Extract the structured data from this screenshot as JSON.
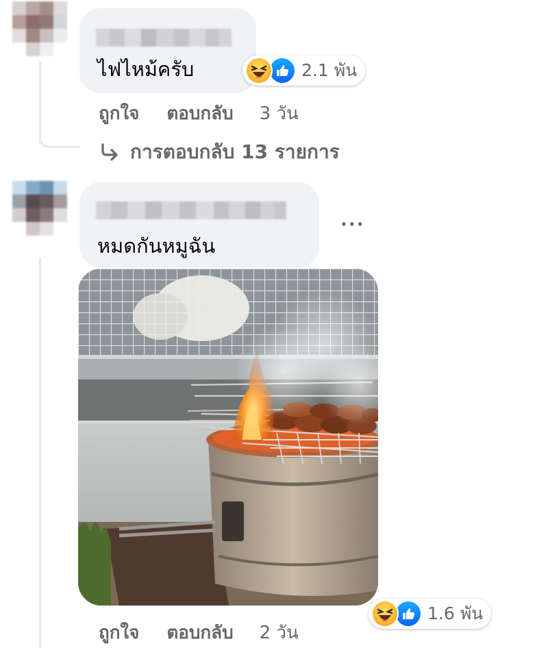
{
  "comments": [
    {
      "text": "ไฟไหม้ครับ",
      "reaction_count": "2.1 พัน",
      "actions": {
        "like": "ถูกใจ",
        "reply": "ตอบกลับ",
        "time": "3 วัน"
      },
      "replies_label": "การตอบกลับ 13 รายการ"
    },
    {
      "text": "หมดกันหมูฉัน",
      "more": "···",
      "reaction_count": "1.6 พัน",
      "actions": {
        "like": "ถูกใจ",
        "reply": "ตอบกลับ",
        "time": "2 วัน"
      }
    }
  ],
  "icons": {
    "reply_arrow": "arrow-return-icon",
    "haha": "haha-reaction-icon",
    "like": "like-reaction-icon"
  },
  "colors": {
    "bubble": "#f0f2f5",
    "secondary_text": "#65676b",
    "like_blue": "#0866ff",
    "haha_yellow": "#f7b125"
  }
}
